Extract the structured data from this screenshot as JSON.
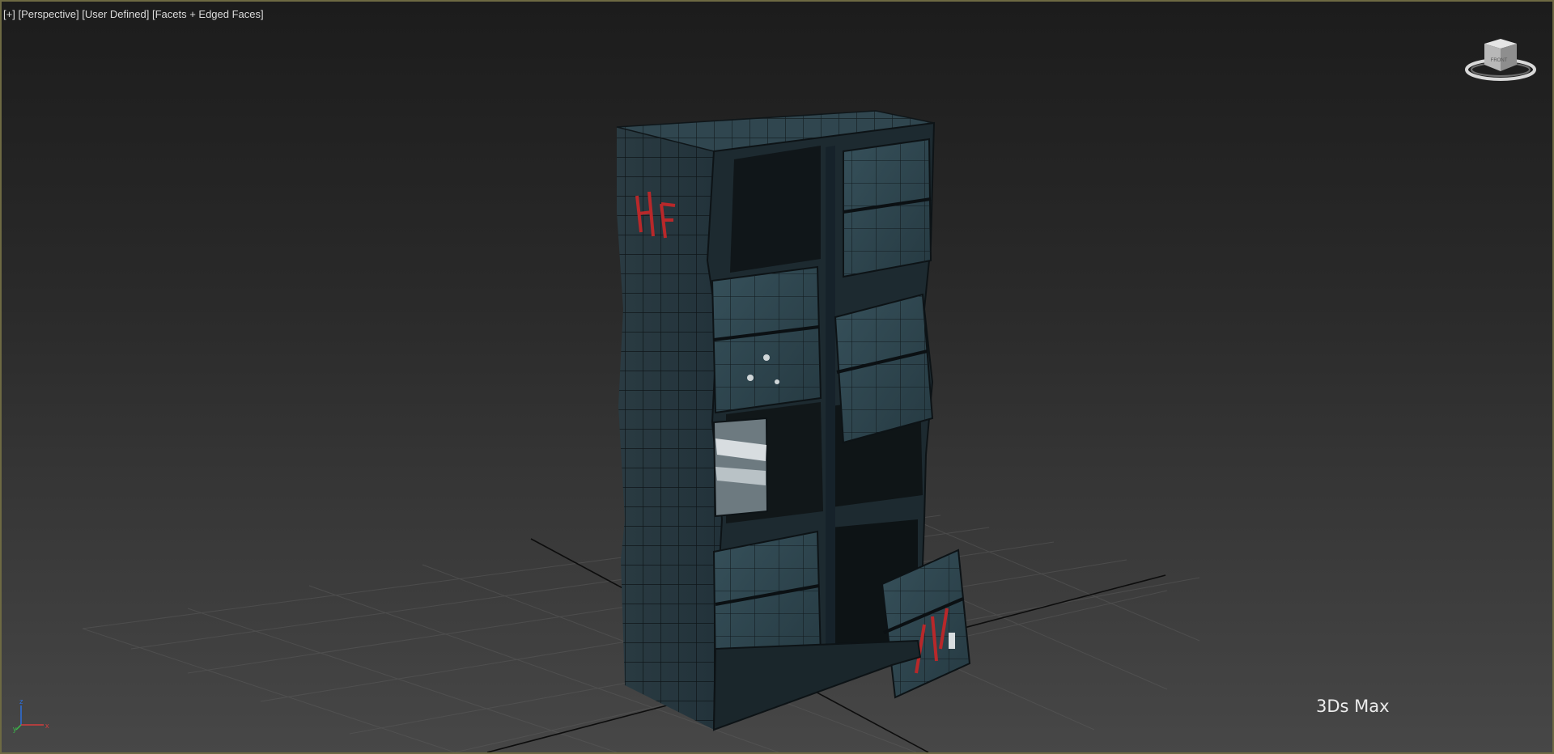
{
  "viewport": {
    "labels": [
      "[+]",
      "[Perspective]",
      "[User Defined]",
      "[Facets + Edged Faces]"
    ],
    "watermark": "3Ds Max",
    "viewcube_label": "FRONT",
    "axis": {
      "x": "x",
      "y": "y",
      "z": "z"
    }
  },
  "colors": {
    "border": "#6e6a43",
    "label_text": "#dcdcdc",
    "model_metal": "#2c4048",
    "graffiti": "#b8282a"
  }
}
